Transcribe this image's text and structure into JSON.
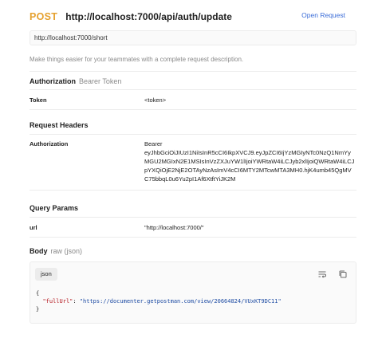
{
  "header": {
    "method": "POST",
    "url": "http://localhost:7000/api/auth/update",
    "open_request": "Open Request"
  },
  "url_box": {
    "value": "http://localhost:7000/short"
  },
  "description": "Make things easier for your teammates with a complete request description.",
  "authorization": {
    "title": "Authorization",
    "type": "Bearer Token",
    "key": "Token",
    "value": "<token>"
  },
  "request_headers": {
    "title": "Request Headers",
    "rows": [
      {
        "key": "Authorization",
        "value_lines": [
          "Bearer",
          "eyJhbGciOiJIUzI1NiIsInR5cCI6IkpXVCJ9.eyJpZCI6IjYzMGIyNTc0NzQ1NmYy",
          "MGU2MGIxN2E1MSIsInVzZXJuYW1lIjoiYWRtaW4iLCJyb2xlIjoiQWRtaW4iLCJ",
          "pYXQiOjE2NjE2OTAyNzAsImV4cCI6MTY2MTcwMTA3MH0.hjK4umb45QgMV",
          "C75bbqL0u6Yu2pI1Af6XtftYiJK2M"
        ]
      }
    ]
  },
  "query_params": {
    "title": "Query Params",
    "rows": [
      {
        "key": "url",
        "value": "\"http://localhost:7000/\""
      }
    ]
  },
  "body": {
    "title": "Body",
    "mode": "raw (json)",
    "format_tag": "json",
    "code": {
      "open": "{",
      "key": "\"fullUrl\"",
      "sep": ": ",
      "value": "\"https://documenter.getpostman.com/view/20664824/VUxKT9DC11\"",
      "close": "}"
    }
  },
  "colors": {
    "method": "#e5a12f",
    "link": "#3a6cd8",
    "json_key": "#b3131a",
    "json_string": "#1d4ba3"
  }
}
